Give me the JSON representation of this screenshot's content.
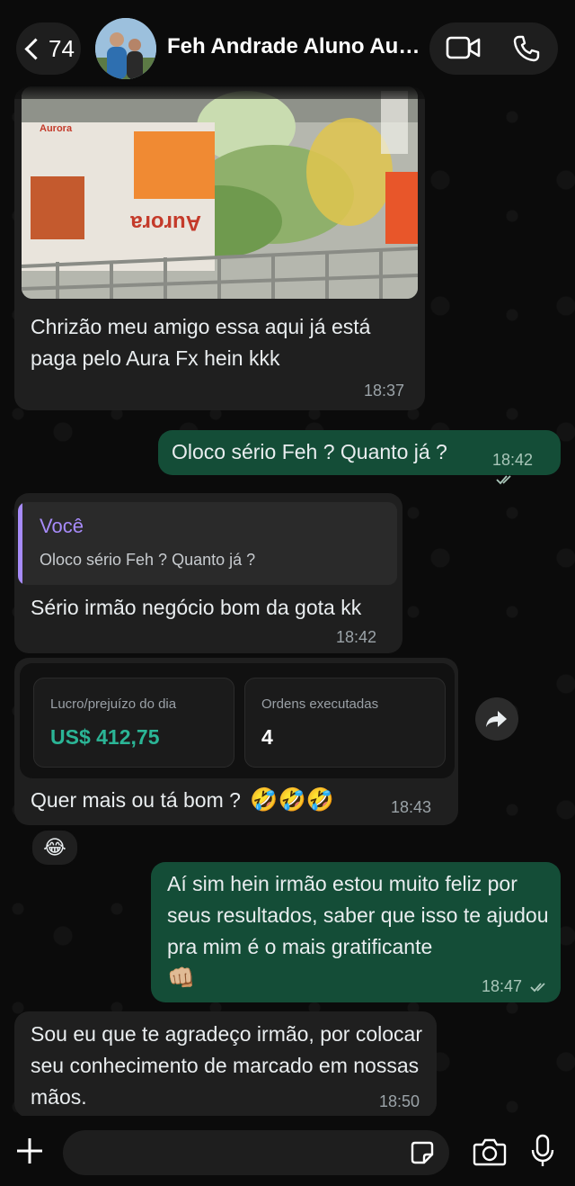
{
  "header": {
    "back_count": "74",
    "contact_name": "Feh Andrade Aluno Aura Fx"
  },
  "messages": [
    {
      "type": "image_caption",
      "direction": "in",
      "image_labels": [
        "Aurora",
        "Aurora"
      ],
      "text": "Chrizão meu amigo essa aqui já está paga pelo Aura Fx hein kkk",
      "time": "18:37"
    },
    {
      "type": "text",
      "direction": "out",
      "text": "Oloco sério Feh ? Quanto já ?",
      "time": "18:42",
      "status": "read"
    },
    {
      "type": "reply",
      "direction": "in",
      "quote_author": "Você",
      "quote_text": "Oloco sério Feh ? Quanto já ?",
      "text": "Sério irmão negócio bom da gota kk",
      "time": "18:42"
    },
    {
      "type": "screenshot_caption",
      "direction": "in",
      "cards": [
        {
          "label": "Lucro/prejuízo do dia",
          "value": "US$ 412,75",
          "color": "#2bb596"
        },
        {
          "label": "Ordens executadas",
          "value": "4",
          "color": "#ffffff"
        }
      ],
      "text": "Quer mais ou tá bom ?",
      "emojis": "🤣🤣🤣",
      "time": "18:43",
      "reaction": "😂"
    },
    {
      "type": "text",
      "direction": "out",
      "text": "Aí sim hein irmão estou muito feliz por seus resultados,  saber que isso te ajudou  pra mim é o mais gratificante",
      "emoji": "👊🏼",
      "time": "18:47",
      "status": "read"
    },
    {
      "type": "text",
      "direction": "in",
      "text": "Sou eu que te agradeço irmão,  por colocar seu conhecimento de marcado em nossas mãos.",
      "time": "18:50"
    }
  ],
  "colors": {
    "incoming_bubble": "#1f1f1f",
    "outgoing_bubble": "#144d37",
    "quote_accent": "#a78bfa",
    "profit_green": "#2bb596"
  },
  "icons": [
    "back-chevron-icon",
    "video-call-icon",
    "phone-icon",
    "forward-icon",
    "plus-icon",
    "sticker-icon",
    "camera-icon",
    "microphone-icon",
    "read-ticks-icon"
  ]
}
